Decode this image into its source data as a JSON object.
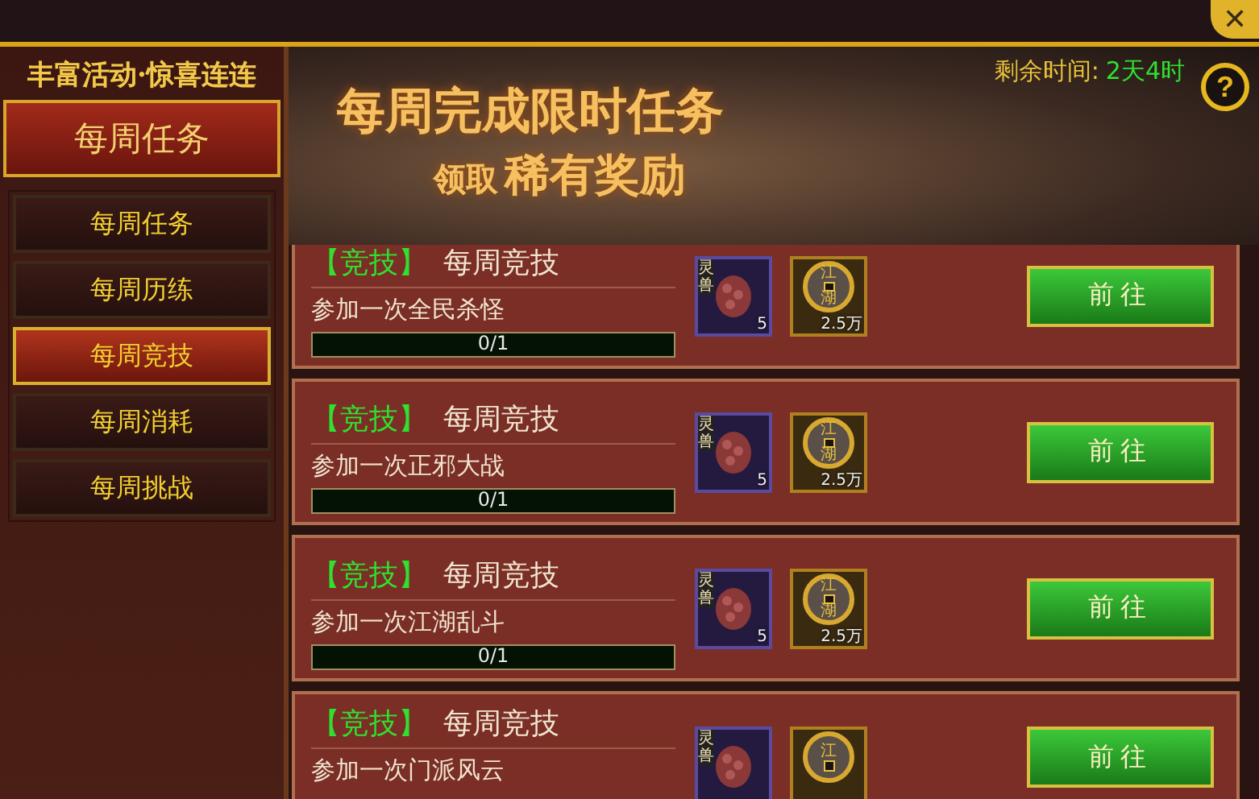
{
  "sidebar": {
    "slogan": "丰富活动·惊喜连连",
    "header": "每周任务",
    "items": [
      {
        "label": "每周任务",
        "selected": false
      },
      {
        "label": "每周历练",
        "selected": false
      },
      {
        "label": "每周竞技",
        "selected": true
      },
      {
        "label": "每周消耗",
        "selected": false
      },
      {
        "label": "每周挑战",
        "selected": false
      }
    ]
  },
  "banner": {
    "headline": "每周完成限时任务",
    "sub_prefix": "领取",
    "sub_emphasis": "稀有奖励",
    "time_label": "剩余时间:",
    "time_value": "2天4时",
    "help": "?"
  },
  "tasks": [
    {
      "category": "【竞技】",
      "name": "每周竞技",
      "description": "参加一次全民杀怪",
      "progress": "0/1",
      "level": 0,
      "rewards": [
        {
          "kind": "beast",
          "tag": "灵兽",
          "count": "5"
        },
        {
          "kind": "coin",
          "marks": [
            "江",
            "湖"
          ],
          "count": "2.5万"
        }
      ],
      "button": "前往"
    },
    {
      "category": "【竞技】",
      "name": "每周竞技",
      "description": "参加一次正邪大战",
      "progress": "0/1",
      "level": 0,
      "rewards": [
        {
          "kind": "beast",
          "tag": "灵兽",
          "count": "5"
        },
        {
          "kind": "coin",
          "marks": [
            "江",
            "湖"
          ],
          "count": "2.5万"
        }
      ],
      "button": "前往"
    },
    {
      "category": "【竞技】",
      "name": "每周竞技",
      "description": "参加一次江湖乱斗",
      "progress": "0/1",
      "level": 0,
      "rewards": [
        {
          "kind": "beast",
          "tag": "灵兽",
          "count": "5"
        },
        {
          "kind": "coin",
          "marks": [
            "江",
            "湖"
          ],
          "count": "2.5万"
        }
      ],
      "button": "前往"
    },
    {
      "category": "【竞技】",
      "name": "每周竞技",
      "description": "参加一次门派风云",
      "rewards": [
        {
          "kind": "beast",
          "tag": "灵兽"
        },
        {
          "kind": "coin",
          "marks": [
            "江"
          ]
        }
      ],
      "button": "前往"
    }
  ],
  "close": "✕"
}
